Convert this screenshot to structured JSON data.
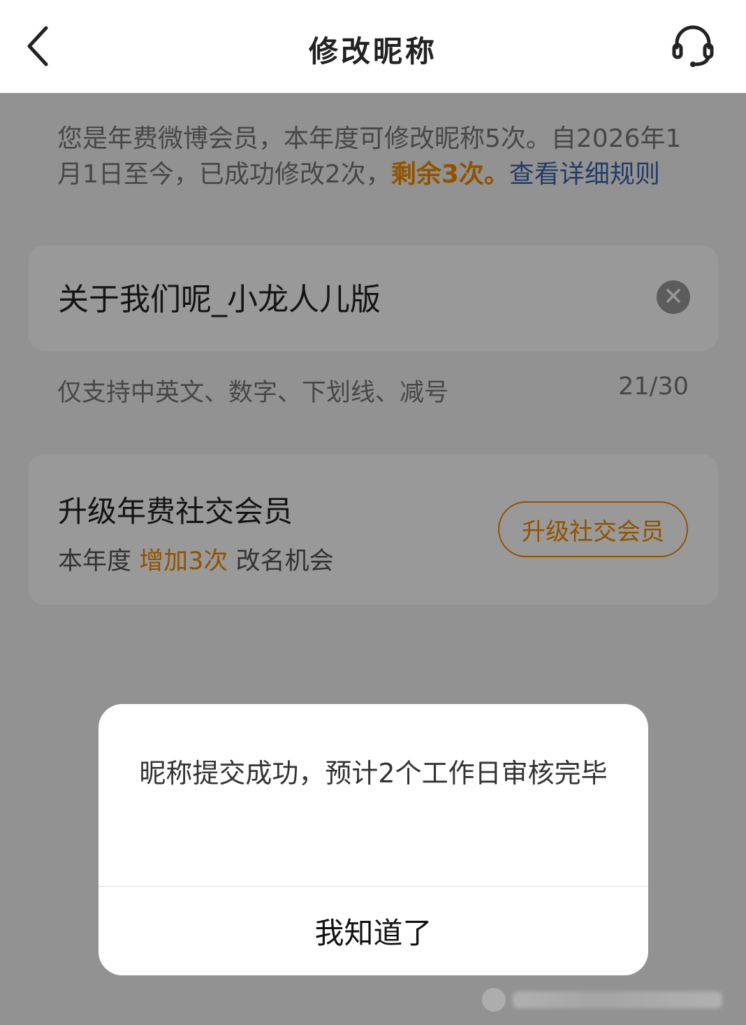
{
  "header": {
    "title": "修改昵称",
    "back_icon": "chevron-left-icon",
    "support_icon": "headset-icon"
  },
  "notice": {
    "text_prefix": "您是年费微博会员，本年度可修改昵称5次。自2026年1月1日至今，已成功修改2次，",
    "remaining": "剩余3次。",
    "rules_link": "查看详细规则",
    "highlight_color": "#f08a00",
    "link_color": "#3e63a8"
  },
  "nickname": {
    "value": "关于我们呢_小龙人儿版",
    "clear_icon": "clear-circle-icon",
    "hint": "仅支持中英文、数字、下划线、减号",
    "count": "21/30"
  },
  "upgrade": {
    "title": "升级年费社交会员",
    "sub_prefix": "本年度",
    "sub_highlight": "增加3次",
    "sub_suffix": "改名机会",
    "button_label": "升级社交会员",
    "accent_color": "#f08a00"
  },
  "dialog": {
    "message": "昵称提交成功，预计2个工作日审核完毕",
    "confirm_label": "我知道了"
  }
}
